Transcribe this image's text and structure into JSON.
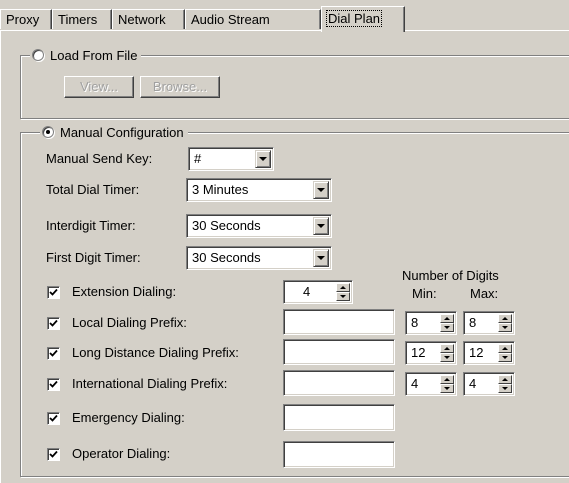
{
  "tabs": [
    {
      "label": "Proxy"
    },
    {
      "label": "Timers"
    },
    {
      "label": "Network"
    },
    {
      "label": "Audio Stream"
    },
    {
      "label": "Dial Plan",
      "active": true
    }
  ],
  "load_from_file": {
    "label": "Load From File",
    "selected": false,
    "view_label": "View...",
    "browse_label": "Browse..."
  },
  "manual_config": {
    "label": "Manual Configuration",
    "selected": true,
    "send_key_label": "Manual Send Key:",
    "send_key_value": "#",
    "total_dial_timer_label": "Total Dial Timer:",
    "total_dial_timer_value": "3 Minutes",
    "interdigit_timer_label": "Interdigit Timer:",
    "interdigit_timer_value": "30 Seconds",
    "first_digit_timer_label": "First Digit Timer:",
    "first_digit_timer_value": "30 Seconds",
    "number_of_digits_label": "Number of Digits",
    "min_label": "Min:",
    "max_label": "Max:",
    "extension": {
      "label": "Extension Dialing:",
      "checked": true,
      "value": "4"
    },
    "local": {
      "label": "Local Dialing Prefix:",
      "checked": true,
      "prefix": "",
      "min": "8",
      "max": "8"
    },
    "long_distance": {
      "label": "Long Distance Dialing Prefix:",
      "checked": true,
      "prefix": "",
      "min": "12",
      "max": "12"
    },
    "international": {
      "label": "International Dialing Prefix:",
      "checked": true,
      "prefix": "",
      "min": "4",
      "max": "4"
    },
    "emergency": {
      "label": "Emergency Dialing:",
      "checked": true,
      "prefix": ""
    },
    "operator": {
      "label": "Operator Dialing:",
      "checked": true,
      "prefix": ""
    }
  },
  "colors": {
    "face": "#d4d0c8",
    "field": "#ffffff",
    "shadow": "#808080",
    "disabled_text": "#a0a0a0"
  }
}
